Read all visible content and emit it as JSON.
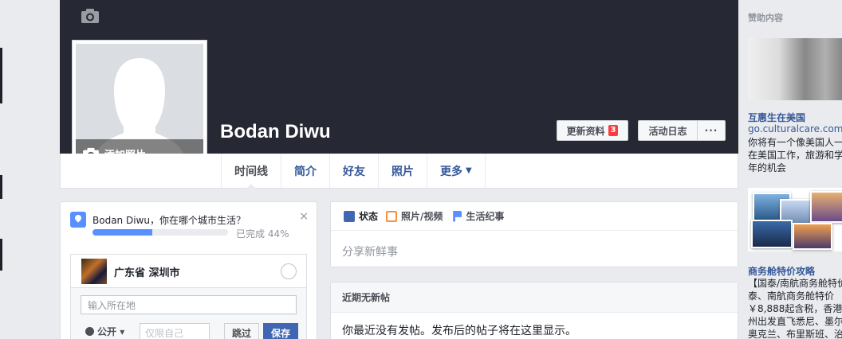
{
  "profile": {
    "name": "Bodan Diwu",
    "add_photo": "添加照片"
  },
  "header_buttons": {
    "update_info": "更新资料",
    "update_badge": "3",
    "activity_log": "活动日志",
    "more": "···"
  },
  "nav": {
    "tabs": [
      {
        "label": "时间线"
      },
      {
        "label": "简介"
      },
      {
        "label": "好友"
      },
      {
        "label": "照片"
      },
      {
        "label": "更多"
      }
    ]
  },
  "city_card": {
    "question": "Bodan Diwu，你在哪个城市生活？",
    "close": "×",
    "progress_percent": 44,
    "progress_text": "已完成 44%",
    "suggestion": "广东省 深圳市",
    "input_placeholder": "输入所在地",
    "privacy": "公开",
    "only_me": "仅限自己",
    "skip": "跳过",
    "save": "保存"
  },
  "composer": {
    "tabs": [
      {
        "label": "状态"
      },
      {
        "label": "照片/视频"
      },
      {
        "label": "生活纪事"
      }
    ],
    "placeholder": "分享新鲜事"
  },
  "recent": {
    "heading": "近期无新帖",
    "body": "你最近没有发帖。发布后的帖子将在这里显示。"
  },
  "sidebar": {
    "sponsored": "赞助内容",
    "ad1": {
      "title": "互惠生在美国",
      "url": "go.culturalcare.com",
      "lines": [
        "你将有一个像美国人一",
        "在美国工作，旅游和学",
        "年的机会"
      ]
    },
    "ad2": {
      "title": "商务舱特价攻略",
      "lines": [
        "【国泰/南航商务舱特价",
        "泰、南航商务舱特价",
        "￥8,888起含税，香港、",
        "州出发直飞悉尼、墨尔",
        "奥克兰、布里斯班、治"
      ]
    }
  }
}
